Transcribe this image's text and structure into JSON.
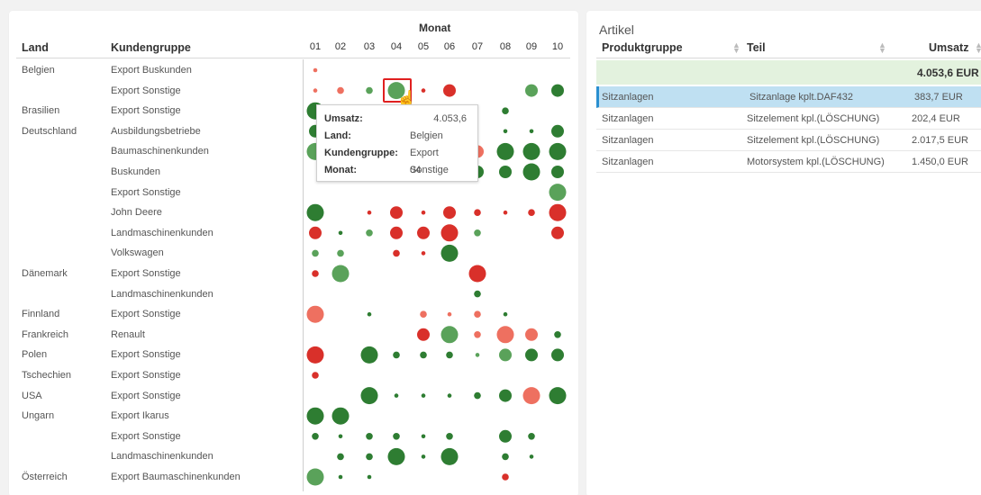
{
  "left": {
    "monat_title": "Monat",
    "col_land": "Land",
    "col_kundengruppe": "Kundengruppe",
    "months": [
      "01",
      "02",
      "03",
      "04",
      "05",
      "06",
      "07",
      "08",
      "09",
      "10"
    ],
    "rows": [
      {
        "land": "Belgien",
        "group": "Export Buskunden"
      },
      {
        "land": "",
        "group": "Export Sonstige"
      },
      {
        "land": "Brasilien",
        "group": "Export Sonstige"
      },
      {
        "land": "Deutschland",
        "group": "Ausbildungsbetriebe"
      },
      {
        "land": "",
        "group": "Baumaschinenkunden"
      },
      {
        "land": "",
        "group": "Buskunden"
      },
      {
        "land": "",
        "group": "Export Sonstige"
      },
      {
        "land": "",
        "group": "John Deere"
      },
      {
        "land": "",
        "group": "Landmaschinenkunden"
      },
      {
        "land": "",
        "group": "Volkswagen"
      },
      {
        "land": "Dänemark",
        "group": "Export Sonstige"
      },
      {
        "land": "",
        "group": "Landmaschinenkunden"
      },
      {
        "land": "Finnland",
        "group": "Export Sonstige"
      },
      {
        "land": "Frankreich",
        "group": "Renault"
      },
      {
        "land": "Polen",
        "group": "Export Sonstige"
      },
      {
        "land": "Tschechien",
        "group": "Export Sonstige"
      },
      {
        "land": "USA",
        "group": "Export Sonstige"
      },
      {
        "land": "Ungarn",
        "group": "Export Ikarus"
      },
      {
        "land": "",
        "group": "Export Sonstige"
      },
      {
        "land": "",
        "group": "Landmaschinenkunden"
      },
      {
        "land": "Österreich",
        "group": "Export Baumaschinenkunden"
      }
    ],
    "colors": {
      "dark_green": "#2e7d32",
      "light_green": "#5aa25a",
      "red": "#d9302a",
      "light_red": "#ee7060"
    },
    "bubbles": [
      {
        "r": 0,
        "m": 1,
        "s": "xs",
        "c": "light_red"
      },
      {
        "r": 1,
        "m": 1,
        "s": "xs",
        "c": "light_red"
      },
      {
        "r": 1,
        "m": 2,
        "s": "sm",
        "c": "light_red"
      },
      {
        "r": 1,
        "m": 3,
        "s": "sm",
        "c": "light_green"
      },
      {
        "r": 1,
        "m": 4,
        "s": "lg",
        "c": "light_green"
      },
      {
        "r": 1,
        "m": 5,
        "s": "xs",
        "c": "red"
      },
      {
        "r": 1,
        "m": 6,
        "s": "md",
        "c": "red"
      },
      {
        "r": 1,
        "m": 9,
        "s": "md",
        "c": "light_green"
      },
      {
        "r": 1,
        "m": 10,
        "s": "md",
        "c": "dark_green"
      },
      {
        "r": 2,
        "m": 1,
        "s": "lg",
        "c": "dark_green"
      },
      {
        "r": 2,
        "m": 5,
        "s": "sm",
        "c": "dark_green"
      },
      {
        "r": 2,
        "m": 8,
        "s": "sm",
        "c": "dark_green"
      },
      {
        "r": 3,
        "m": 1,
        "s": "md",
        "c": "dark_green"
      },
      {
        "r": 3,
        "m": 8,
        "s": "xs",
        "c": "dark_green"
      },
      {
        "r": 3,
        "m": 9,
        "s": "xs",
        "c": "dark_green"
      },
      {
        "r": 3,
        "m": 10,
        "s": "md",
        "c": "dark_green"
      },
      {
        "r": 4,
        "m": 1,
        "s": "lg",
        "c": "light_green"
      },
      {
        "r": 4,
        "m": 7,
        "s": "md",
        "c": "light_red"
      },
      {
        "r": 4,
        "m": 8,
        "s": "lg",
        "c": "dark_green"
      },
      {
        "r": 4,
        "m": 9,
        "s": "lg",
        "c": "dark_green"
      },
      {
        "r": 4,
        "m": 10,
        "s": "lg",
        "c": "dark_green"
      },
      {
        "r": 5,
        "m": 7,
        "s": "md",
        "c": "dark_green"
      },
      {
        "r": 5,
        "m": 8,
        "s": "md",
        "c": "dark_green"
      },
      {
        "r": 5,
        "m": 9,
        "s": "lg",
        "c": "dark_green"
      },
      {
        "r": 5,
        "m": 10,
        "s": "md",
        "c": "dark_green"
      },
      {
        "r": 6,
        "m": 10,
        "s": "lg",
        "c": "light_green"
      },
      {
        "r": 7,
        "m": 1,
        "s": "lg",
        "c": "dark_green"
      },
      {
        "r": 7,
        "m": 3,
        "s": "xs",
        "c": "red"
      },
      {
        "r": 7,
        "m": 4,
        "s": "md",
        "c": "red"
      },
      {
        "r": 7,
        "m": 5,
        "s": "xs",
        "c": "red"
      },
      {
        "r": 7,
        "m": 6,
        "s": "md",
        "c": "red"
      },
      {
        "r": 7,
        "m": 7,
        "s": "sm",
        "c": "red"
      },
      {
        "r": 7,
        "m": 8,
        "s": "xs",
        "c": "red"
      },
      {
        "r": 7,
        "m": 9,
        "s": "sm",
        "c": "red"
      },
      {
        "r": 7,
        "m": 10,
        "s": "lg",
        "c": "red"
      },
      {
        "r": 8,
        "m": 1,
        "s": "md",
        "c": "red"
      },
      {
        "r": 8,
        "m": 2,
        "s": "xs",
        "c": "dark_green"
      },
      {
        "r": 8,
        "m": 3,
        "s": "sm",
        "c": "light_green"
      },
      {
        "r": 8,
        "m": 4,
        "s": "md",
        "c": "red"
      },
      {
        "r": 8,
        "m": 5,
        "s": "md",
        "c": "red"
      },
      {
        "r": 8,
        "m": 6,
        "s": "lg",
        "c": "red"
      },
      {
        "r": 8,
        "m": 7,
        "s": "sm",
        "c": "light_green"
      },
      {
        "r": 8,
        "m": 10,
        "s": "md",
        "c": "red"
      },
      {
        "r": 9,
        "m": 1,
        "s": "sm",
        "c": "light_green"
      },
      {
        "r": 9,
        "m": 2,
        "s": "sm",
        "c": "light_green"
      },
      {
        "r": 9,
        "m": 4,
        "s": "sm",
        "c": "red"
      },
      {
        "r": 9,
        "m": 5,
        "s": "xs",
        "c": "red"
      },
      {
        "r": 9,
        "m": 6,
        "s": "lg",
        "c": "dark_green"
      },
      {
        "r": 10,
        "m": 1,
        "s": "sm",
        "c": "red"
      },
      {
        "r": 10,
        "m": 2,
        "s": "lg",
        "c": "light_green"
      },
      {
        "r": 10,
        "m": 7,
        "s": "lg",
        "c": "red"
      },
      {
        "r": 11,
        "m": 7,
        "s": "sm",
        "c": "dark_green"
      },
      {
        "r": 12,
        "m": 1,
        "s": "lg",
        "c": "light_red"
      },
      {
        "r": 12,
        "m": 3,
        "s": "xs",
        "c": "dark_green"
      },
      {
        "r": 12,
        "m": 5,
        "s": "sm",
        "c": "light_red"
      },
      {
        "r": 12,
        "m": 6,
        "s": "xs",
        "c": "light_red"
      },
      {
        "r": 12,
        "m": 7,
        "s": "sm",
        "c": "light_red"
      },
      {
        "r": 12,
        "m": 8,
        "s": "xs",
        "c": "dark_green"
      },
      {
        "r": 13,
        "m": 5,
        "s": "md",
        "c": "red"
      },
      {
        "r": 13,
        "m": 6,
        "s": "lg",
        "c": "light_green"
      },
      {
        "r": 13,
        "m": 7,
        "s": "sm",
        "c": "light_red"
      },
      {
        "r": 13,
        "m": 8,
        "s": "lg",
        "c": "light_red"
      },
      {
        "r": 13,
        "m": 9,
        "s": "md",
        "c": "light_red"
      },
      {
        "r": 13,
        "m": 10,
        "s": "sm",
        "c": "dark_green"
      },
      {
        "r": 14,
        "m": 1,
        "s": "lg",
        "c": "red"
      },
      {
        "r": 14,
        "m": 3,
        "s": "lg",
        "c": "dark_green"
      },
      {
        "r": 14,
        "m": 4,
        "s": "sm",
        "c": "dark_green"
      },
      {
        "r": 14,
        "m": 5,
        "s": "sm",
        "c": "dark_green"
      },
      {
        "r": 14,
        "m": 6,
        "s": "sm",
        "c": "dark_green"
      },
      {
        "r": 14,
        "m": 7,
        "s": "xs",
        "c": "light_green"
      },
      {
        "r": 14,
        "m": 8,
        "s": "md",
        "c": "light_green"
      },
      {
        "r": 14,
        "m": 9,
        "s": "md",
        "c": "dark_green"
      },
      {
        "r": 14,
        "m": 10,
        "s": "md",
        "c": "dark_green"
      },
      {
        "r": 15,
        "m": 1,
        "s": "sm",
        "c": "red"
      },
      {
        "r": 16,
        "m": 3,
        "s": "lg",
        "c": "dark_green"
      },
      {
        "r": 16,
        "m": 4,
        "s": "xs",
        "c": "dark_green"
      },
      {
        "r": 16,
        "m": 5,
        "s": "xs",
        "c": "dark_green"
      },
      {
        "r": 16,
        "m": 6,
        "s": "xs",
        "c": "dark_green"
      },
      {
        "r": 16,
        "m": 7,
        "s": "sm",
        "c": "dark_green"
      },
      {
        "r": 16,
        "m": 8,
        "s": "md",
        "c": "dark_green"
      },
      {
        "r": 16,
        "m": 9,
        "s": "lg",
        "c": "light_red"
      },
      {
        "r": 16,
        "m": 10,
        "s": "lg",
        "c": "dark_green"
      },
      {
        "r": 17,
        "m": 1,
        "s": "lg",
        "c": "dark_green"
      },
      {
        "r": 17,
        "m": 2,
        "s": "lg",
        "c": "dark_green"
      },
      {
        "r": 18,
        "m": 1,
        "s": "sm",
        "c": "dark_green"
      },
      {
        "r": 18,
        "m": 2,
        "s": "xs",
        "c": "dark_green"
      },
      {
        "r": 18,
        "m": 3,
        "s": "sm",
        "c": "dark_green"
      },
      {
        "r": 18,
        "m": 4,
        "s": "sm",
        "c": "dark_green"
      },
      {
        "r": 18,
        "m": 5,
        "s": "xs",
        "c": "dark_green"
      },
      {
        "r": 18,
        "m": 6,
        "s": "sm",
        "c": "dark_green"
      },
      {
        "r": 18,
        "m": 8,
        "s": "md",
        "c": "dark_green"
      },
      {
        "r": 18,
        "m": 9,
        "s": "sm",
        "c": "dark_green"
      },
      {
        "r": 19,
        "m": 2,
        "s": "sm",
        "c": "dark_green"
      },
      {
        "r": 19,
        "m": 3,
        "s": "sm",
        "c": "dark_green"
      },
      {
        "r": 19,
        "m": 4,
        "s": "lg",
        "c": "dark_green"
      },
      {
        "r": 19,
        "m": 5,
        "s": "xs",
        "c": "dark_green"
      },
      {
        "r": 19,
        "m": 6,
        "s": "lg",
        "c": "dark_green"
      },
      {
        "r": 19,
        "m": 8,
        "s": "sm",
        "c": "dark_green"
      },
      {
        "r": 19,
        "m": 9,
        "s": "xs",
        "c": "dark_green"
      },
      {
        "r": 20,
        "m": 1,
        "s": "lg",
        "c": "light_green"
      },
      {
        "r": 20,
        "m": 2,
        "s": "xs",
        "c": "dark_green"
      },
      {
        "r": 20,
        "m": 3,
        "s": "xs",
        "c": "dark_green"
      },
      {
        "r": 20,
        "m": 8,
        "s": "sm",
        "c": "red"
      }
    ],
    "tooltip": {
      "umsatz_label": "Umsatz:",
      "umsatz_value": "4.053,6",
      "land_label": "Land:",
      "land_value": "Belgien",
      "kundengruppe_label": "Kundengruppe:",
      "kundengruppe_value": "Export Sonstige",
      "monat_label": "Monat:",
      "monat_value": "04"
    }
  },
  "right": {
    "title": "Artikel",
    "col_produktgruppe": "Produktgruppe",
    "col_teil": "Teil",
    "col_umsatz": "Umsatz",
    "total": "4.053,6 EUR",
    "rows": [
      {
        "produktgruppe": "Sitzanlagen",
        "teil": "Sitzanlage kplt.DAF432",
        "umsatz": "383,7 EUR"
      },
      {
        "produktgruppe": "Sitzanlagen",
        "teil": "Sitzelement kpl.(LÖSCHUNG)",
        "umsatz": "202,4 EUR"
      },
      {
        "produktgruppe": "Sitzanlagen",
        "teil": "Sitzelement kpl.(LÖSCHUNG)",
        "umsatz": "2.017,5 EUR"
      },
      {
        "produktgruppe": "Sitzanlagen",
        "teil": "Motorsystem kpl.(LÖSCHUNG)",
        "umsatz": "1.450,0 EUR"
      }
    ]
  }
}
